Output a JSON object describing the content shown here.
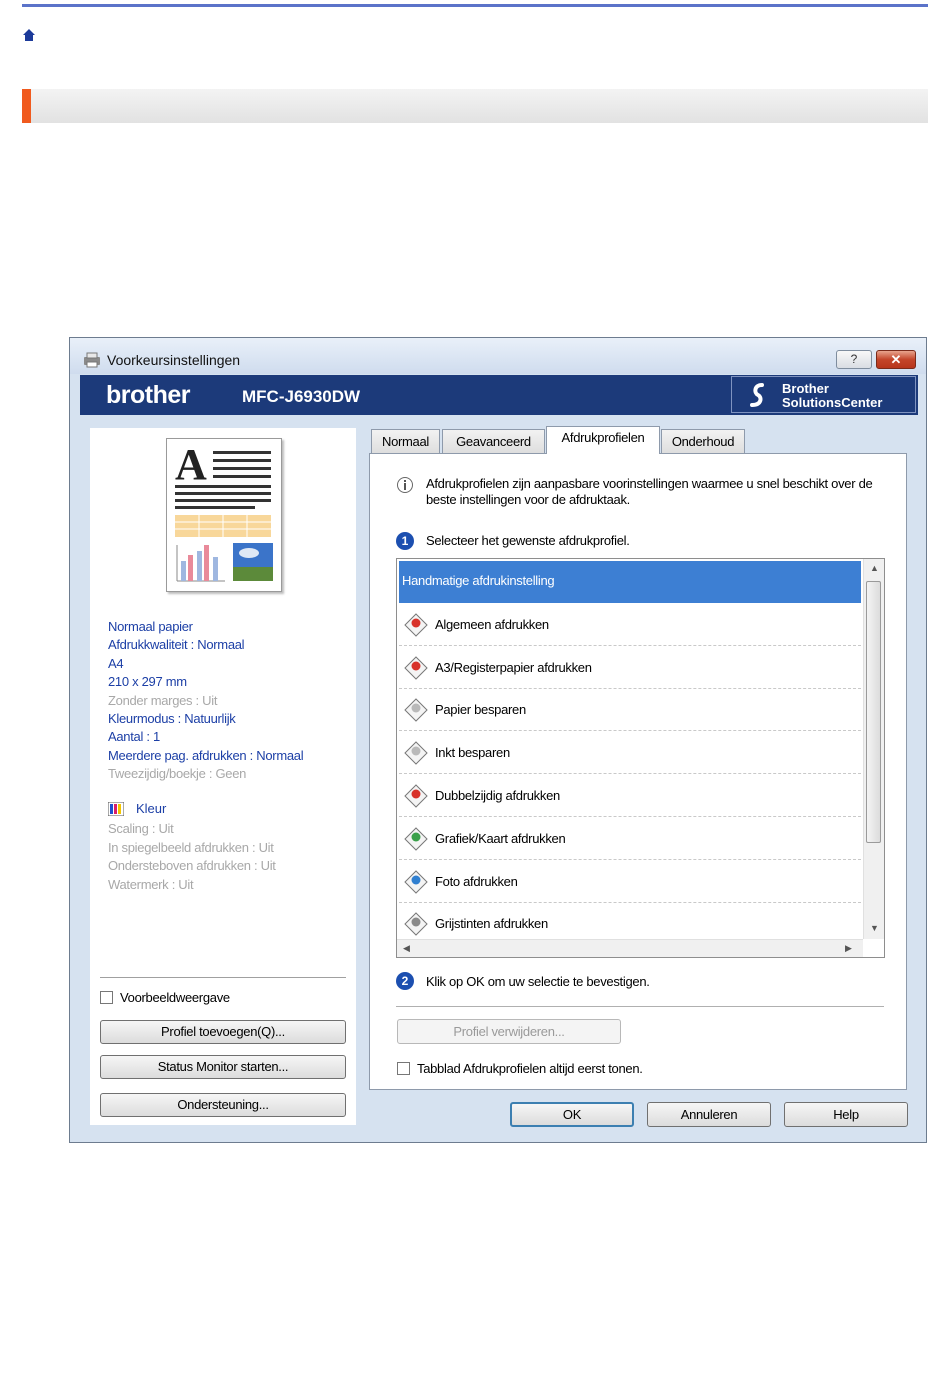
{
  "dialog": {
    "title": "Voorkeursinstellingen",
    "help_btn": "?",
    "close_btn": "✕",
    "brand": "brother",
    "model": "MFC-J6930DW",
    "solutions_center": [
      "Brother",
      "SolutionsCenter"
    ]
  },
  "summary": {
    "lines": [
      {
        "text": "Normaal papier",
        "enabled": true
      },
      {
        "text": "Afdrukkwaliteit : Normaal",
        "enabled": true
      },
      {
        "text": "A4",
        "enabled": true
      },
      {
        "text": "210 x 297 mm",
        "enabled": true
      },
      {
        "text": "Zonder marges : Uit",
        "enabled": false
      },
      {
        "text": "Kleurmodus : Natuurlijk",
        "enabled": true
      },
      {
        "text": "Aantal : 1",
        "enabled": true
      },
      {
        "text": "Meerdere pag. afdrukken : Normaal",
        "enabled": true
      },
      {
        "text": "Tweezijdig/boekje : Geen",
        "enabled": false
      }
    ],
    "kleur": "Kleur",
    "lines2": [
      {
        "text": "Scaling : Uit",
        "enabled": false
      },
      {
        "text": "In spiegelbeeld afdrukken : Uit",
        "enabled": false
      },
      {
        "text": "Ondersteboven afdrukken : Uit",
        "enabled": false
      },
      {
        "text": "Watermerk : Uit",
        "enabled": false
      }
    ]
  },
  "left": {
    "preview_checkbox": "Voorbeeldweergave",
    "buttons": [
      "Profiel toevoegen(Q)...",
      "Status Monitor starten...",
      "Ondersteuning..."
    ]
  },
  "tabs": [
    "Normaal",
    "Geavanceerd",
    "Afdrukprofielen",
    "Onderhoud"
  ],
  "profiles": {
    "info": "Afdrukprofielen zijn aanpasbare voorinstellingen waarmee u snel beschikt over de beste instellingen voor de afdruktaak.",
    "step1": "Selecteer het gewenste afdrukprofiel.",
    "items": [
      "Handmatige afdrukinstelling",
      "Algemeen afdrukken",
      "A3/Registerpapier afdrukken",
      "Papier besparen",
      "Inkt besparen",
      "Dubbelzijdig afdrukken",
      "Grafiek/Kaart afdrukken",
      "Foto afdrukken",
      "Grijstinten afdrukken"
    ],
    "selected_index": 0,
    "step2": "Klik op OK om uw selectie te bevestigen.",
    "delete_btn": "Profiel verwijderen...",
    "always_show": "Tabblad Afdrukprofielen altijd eerst tonen."
  },
  "footer": {
    "ok": "OK",
    "cancel": "Annuleren",
    "help": "Help"
  },
  "colors": {
    "accent_bar": "#f05a1e",
    "brand_bg": "#1c3a7a",
    "selection": "#3d7fd3",
    "summary_text": "#1c3fa6"
  }
}
